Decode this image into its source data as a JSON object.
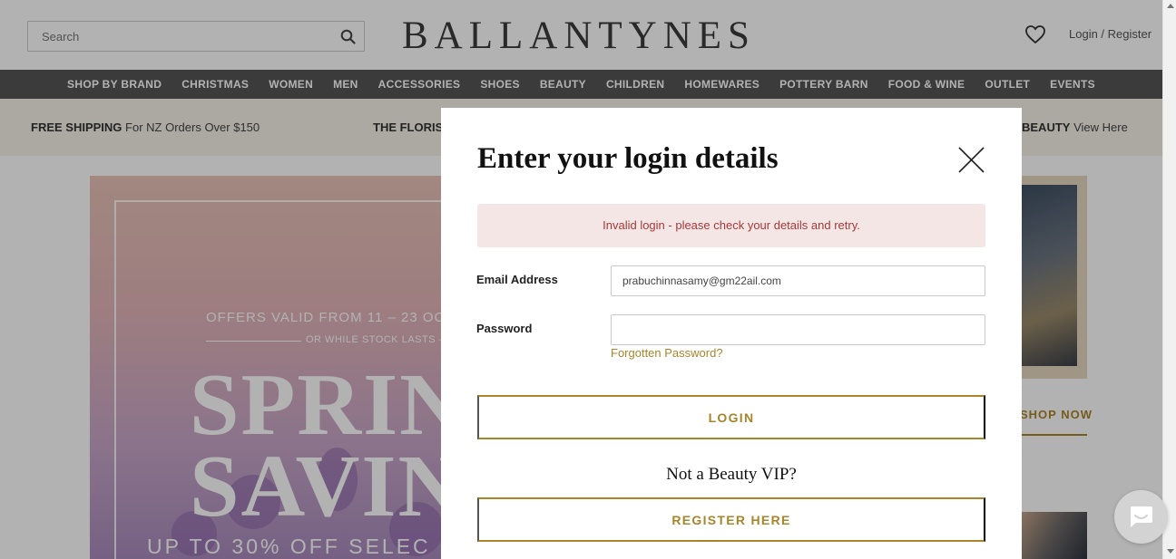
{
  "header": {
    "search_placeholder": "Search",
    "logo": "BALLANTYNES",
    "login_register": "Login / Register"
  },
  "nav": {
    "items": [
      "SHOP BY BRAND",
      "CHRISTMAS",
      "WOMEN",
      "MEN",
      "ACCESSORIES",
      "SHOES",
      "BEAUTY",
      "CHILDREN",
      "HOMEWARES",
      "POTTERY BARN",
      "FOOD & WINE",
      "OUTLET",
      "EVENTS"
    ]
  },
  "promo": {
    "shipping_bold": "FREE SHIPPING",
    "shipping_text": "For NZ Orders Over $150",
    "florist_bold": "THE FLORIS",
    "beauty_bold": "BEAUTY",
    "beauty_text": "View Here"
  },
  "hero": {
    "offer": "OFFERS VALID FROM 11 – 23 OC",
    "stock": "OR WHILE STOCK LASTS –",
    "line1": "SPRIN",
    "line2": "SAVIN",
    "bottom": "UP TO 30% OFF SELEC"
  },
  "side": {
    "shop_now": "SHOP NOW"
  },
  "modal": {
    "title": "Enter your login details",
    "error": "Invalid login - please check your details and retry.",
    "email_label": "Email Address",
    "email_value": "prabuchinnasamy@gm22ail.com",
    "password_label": "Password",
    "password_value": "",
    "forgot": "Forgotten Password?",
    "login_button": "LOGIN",
    "not_vip": "Not a Beauty VIP?",
    "register_button": "REGISTER HERE"
  },
  "colors": {
    "accent": "#a8852a",
    "nav_bg": "#555555",
    "error_bg": "#f5e6e6",
    "error_text": "#a63a3a"
  }
}
